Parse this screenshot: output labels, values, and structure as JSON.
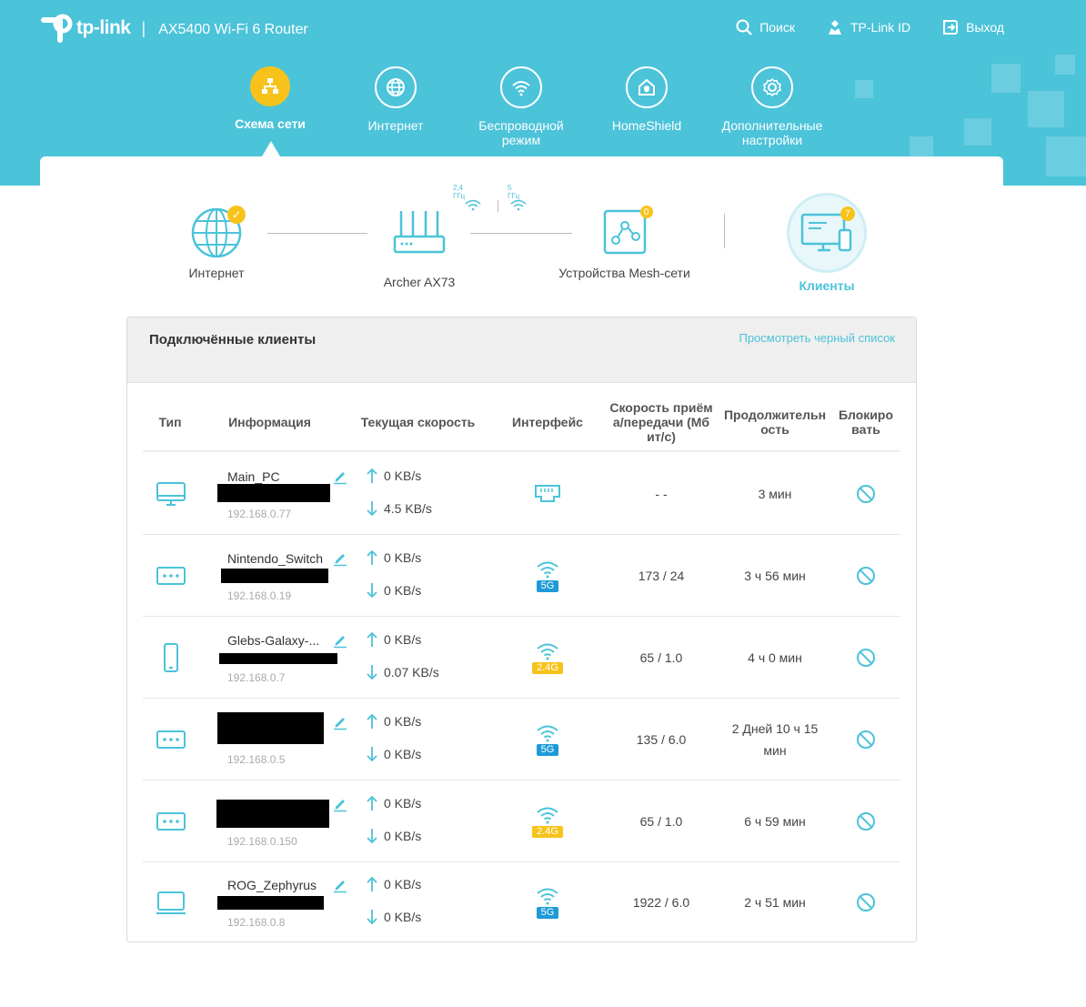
{
  "header": {
    "brand": "tp-link",
    "model": "AX5400 Wi-Fi 6 Router",
    "actions": [
      {
        "label": "Поиск",
        "icon": "search-icon"
      },
      {
        "label": "TP-Link ID",
        "icon": "user-id-icon"
      },
      {
        "label": "Выход",
        "icon": "logout-icon"
      }
    ]
  },
  "nav": [
    {
      "label": "Схема сети",
      "icon": "network-map-icon",
      "active": true
    },
    {
      "label": "Интернет",
      "icon": "globe-icon",
      "active": false
    },
    {
      "label": "Беспроводной режим",
      "icon": "wifi-icon",
      "active": false
    },
    {
      "label": "HomeShield",
      "icon": "home-shield-icon",
      "active": false
    },
    {
      "label": "Дополнительные настройки",
      "icon": "gear-icon",
      "active": false
    }
  ],
  "topology": {
    "internet": {
      "label": "Интернет",
      "status": "connected"
    },
    "router": {
      "label": "Archer AX73",
      "band_24": "2,4 ГГц",
      "band_5": "5 ГГц"
    },
    "mesh": {
      "label": "Устройства Mesh-сети",
      "count": "0"
    },
    "clients": {
      "label": "Клиенты",
      "count": "7"
    }
  },
  "clients_card": {
    "title": "Подключённые клиенты",
    "blacklist_link": "Просмотреть черный список",
    "columns": {
      "type": "Тип",
      "info": "Информация",
      "speed": "Текущая скорость",
      "interface": "Интерфейс",
      "rate": "Скорость приём а/передачи (Мб ит/с)",
      "duration": "Продолжительн ость",
      "block": "Блокиро вать"
    },
    "rows": [
      {
        "type": "desktop",
        "name": "Main_PC",
        "ip": "192.168.0.77",
        "up": "0 KB/s",
        "down": "4.5 KB/s",
        "interface": "wired",
        "band": "",
        "rate": "- -",
        "duration": "3 мин"
      },
      {
        "type": "other",
        "name": "Nintendo_Switch",
        "ip": "192.168.0.19",
        "up": "0 KB/s",
        "down": "0 KB/s",
        "interface": "wifi",
        "band": "5G",
        "rate": "173 / 24",
        "duration": "3 ч 56 мин"
      },
      {
        "type": "phone",
        "name": "Glebs-Galaxy-...",
        "ip": "192.168.0.7",
        "up": "0 KB/s",
        "down": "0.07 KB/s",
        "interface": "wifi",
        "band": "2.4G",
        "rate": "65 / 1.0",
        "duration": "4 ч 0 мин"
      },
      {
        "type": "other",
        "name": "",
        "ip": "192.168.0.5",
        "up": "0 KB/s",
        "down": "0 KB/s",
        "interface": "wifi",
        "band": "5G",
        "rate": "135 / 6.0",
        "duration": "2 Дней 10 ч 15 мин"
      },
      {
        "type": "other",
        "name": "",
        "ip": "192.168.0.150",
        "up": "0 KB/s",
        "down": "0 KB/s",
        "interface": "wifi",
        "band": "2.4G",
        "rate": "65 / 1.0",
        "duration": "6 ч 59 мин"
      },
      {
        "type": "laptop",
        "name": "ROG_Zephyrus",
        "ip": "192.168.0.8",
        "up": "0 KB/s",
        "down": "0 KB/s",
        "interface": "wifi",
        "band": "5G",
        "rate": "1922 / 6.0",
        "duration": "2 ч 51 мин"
      }
    ]
  },
  "colors": {
    "header_bg": "#4bc3d9",
    "accent": "#4bc3d9",
    "active_nav": "#f7c31b",
    "band_5g": "#1e9bd7",
    "band_24g": "#f7c31b"
  }
}
